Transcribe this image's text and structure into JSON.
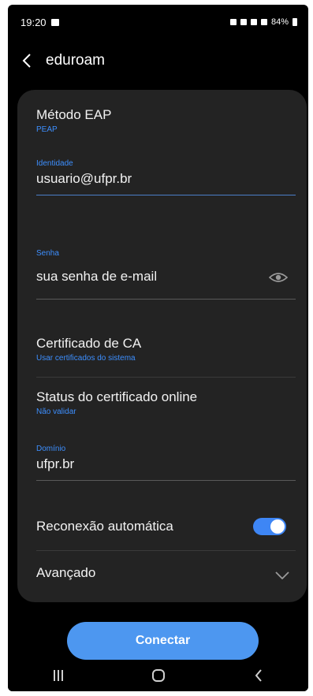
{
  "status_bar": {
    "time": "19:20",
    "battery": "84%"
  },
  "header": {
    "title": "eduroam"
  },
  "form": {
    "eap_method": {
      "label": "Método EAP",
      "value": "PEAP"
    },
    "identity": {
      "label": "Identidade",
      "value": "usuario@ufpr.br"
    },
    "password": {
      "label": "Senha",
      "value": "sua senha de e-mail"
    },
    "ca_certificate": {
      "label": "Certificado de CA",
      "value": "Usar certificados do sistema"
    },
    "online_cert_status": {
      "label": "Status do certificado online",
      "value": "Não validar"
    },
    "domain": {
      "label": "Domínio",
      "value": "ufpr.br"
    },
    "auto_reconnect": {
      "label": "Reconexão automática",
      "enabled": true
    },
    "advanced": {
      "label": "Avançado"
    }
  },
  "actions": {
    "connect": "Conectar"
  },
  "colors": {
    "accent": "#3d8fff",
    "button": "#4d97f0",
    "card": "#232323",
    "background": "#000000"
  },
  "icons": [
    "back-icon",
    "eye-icon",
    "chevron-down-icon",
    "recent-apps-icon",
    "home-icon",
    "nav-back-icon"
  ]
}
